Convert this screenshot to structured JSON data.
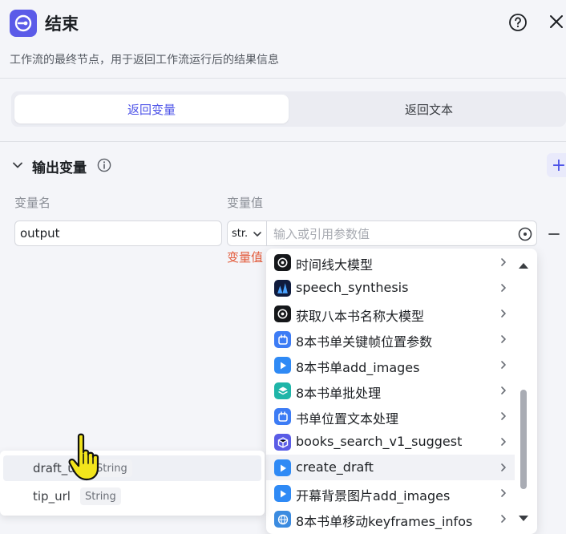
{
  "header": {
    "title": "结束",
    "description": "工作流的最终节点，用于返回工作流运行后的结果信息"
  },
  "tabs": [
    {
      "label": "返回变量",
      "active": true
    },
    {
      "label": "返回文本",
      "active": false
    }
  ],
  "output_section": {
    "title": "输出变量",
    "col_name_label": "变量名",
    "col_value_label": "变量值"
  },
  "variable_row": {
    "name_value": "output",
    "type_value": "str.",
    "value_placeholder": "输入或引用参数值",
    "error_text": "变量值"
  },
  "dropdown": {
    "items": [
      {
        "label": "时间线大模型",
        "icon": "openai-icon"
      },
      {
        "label": "speech_synthesis",
        "icon": "soundwave-icon"
      },
      {
        "label": "获取八本书名称大模型",
        "icon": "openai-icon"
      },
      {
        "label": "8本书单关键帧位置参数",
        "icon": "plugin-icon"
      },
      {
        "label": "8本书单add_images",
        "icon": "play-icon"
      },
      {
        "label": "8本书单批处理",
        "icon": "batch-icon"
      },
      {
        "label": "书单位置文本处理",
        "icon": "plugin-icon"
      },
      {
        "label": "books_search_v1_suggest",
        "icon": "cube-icon"
      },
      {
        "label": "create_draft",
        "icon": "play-icon"
      },
      {
        "label": "开幕背景图片add_images",
        "icon": "play-icon"
      },
      {
        "label": "8本书单移动keyframes_infos",
        "icon": "globe-icon"
      }
    ]
  },
  "fields": [
    {
      "name": "draft_url",
      "type": "String"
    },
    {
      "name": "tip_url",
      "type": "String"
    }
  ],
  "colors": {
    "accent": "#4d53e8",
    "error": "#e25a3a",
    "node_icon": "#5b5be8"
  }
}
